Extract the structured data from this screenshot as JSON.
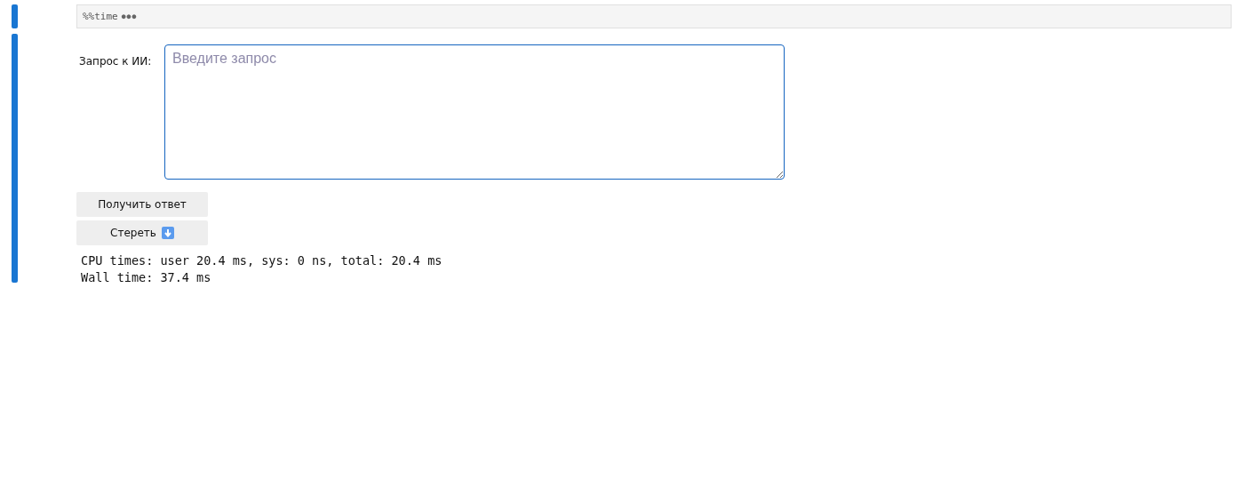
{
  "code_cell": {
    "source": "%%time",
    "collapsed_marker": "●●●"
  },
  "output_cell": {
    "prompt_label": "Запрос к ИИ:",
    "prompt_field": {
      "placeholder": "Введите запрос"
    },
    "buttons": [
      {
        "label": "Получить ответ",
        "kind": "text"
      },
      {
        "label": "Стереть",
        "kind": "icon"
      }
    ],
    "output_lines": [
      "CPU times: user 20.4 ms, sys: 0 ns, total: 20.4 ms",
      "Wall time: 37.4 ms"
    ]
  }
}
